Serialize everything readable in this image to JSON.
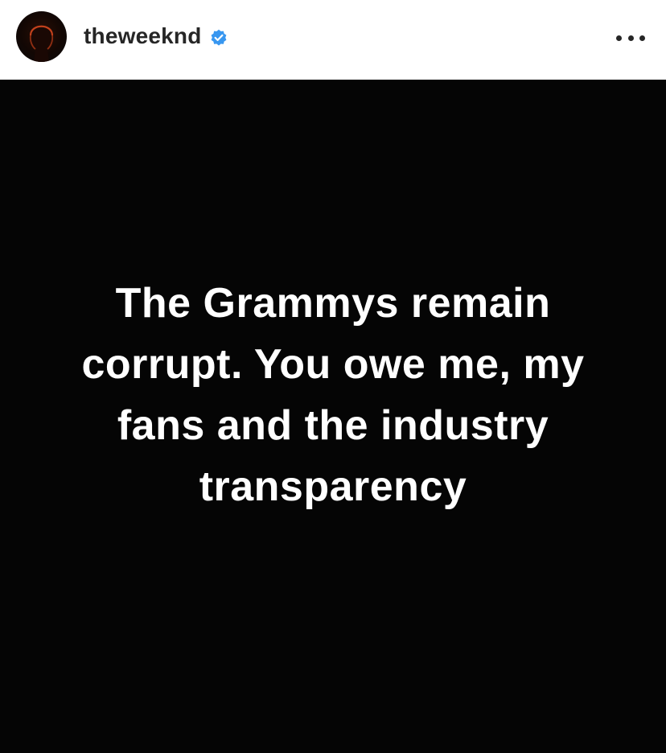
{
  "header": {
    "username": "theweeknd",
    "verified": true,
    "avatar_icon": "profile-avatar",
    "verified_icon": "verified-badge-icon",
    "verified_color": "#3897f0",
    "more_icon": "more-options-icon"
  },
  "post": {
    "background_color": "#050505",
    "text_color": "#ffffff",
    "lines": [
      "The Grammys remain",
      "corrupt. You owe me, my",
      "fans and the industry",
      "transparency"
    ]
  }
}
